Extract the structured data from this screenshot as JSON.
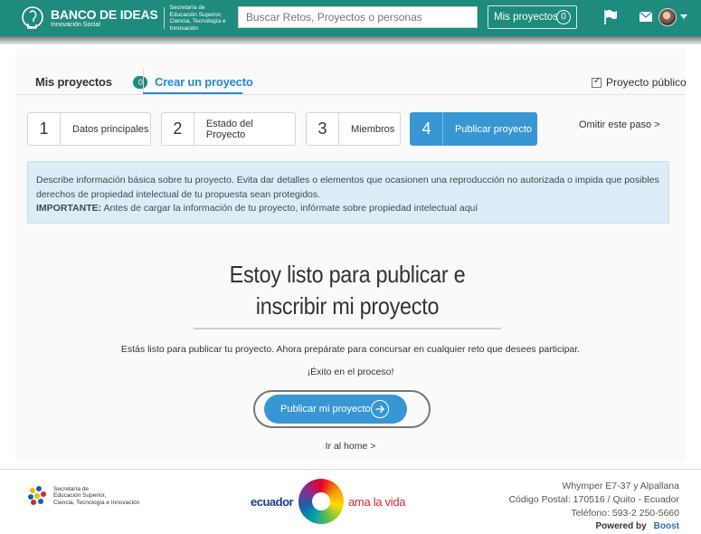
{
  "header": {
    "brand_title": "BANCO DE IDEAS",
    "brand_subtitle": "Innovación Social",
    "org_line1": "Secretaría de",
    "org_line2": "Educación Superior,",
    "org_line3": "Ciencia, Tecnología e Innovación",
    "search_placeholder": "Buscar Retos, Proyectos o personas",
    "my_projects_label": "Mis proyectos",
    "my_projects_count": "0"
  },
  "tabs": {
    "mis_proyectos": "Mis proyectos",
    "mis_proyectos_count": "0",
    "crear_proyecto": "Crear un proyecto",
    "public_label": "Proyecto público"
  },
  "steps": [
    {
      "num": "1",
      "label": "Datos principales"
    },
    {
      "num": "2",
      "label": "Estado del Proyecto"
    },
    {
      "num": "3",
      "label": "Miembros"
    },
    {
      "num": "4",
      "label": "Publicar proyecto"
    }
  ],
  "skip_label": "Omitir este paso >",
  "alert": {
    "line1": "Describe información básica sobre tu proyecto. Evita dar detalles o elementos que ocasionen una reproducción no autorizada o impida que posibles",
    "line2": "derechos de propiedad intelectual de tu propuesta sean protegidos.",
    "important_label": "IMPORTANTE:",
    "important_text": " Antes de cargar la información de tu proyecto, infórmate sobre propiedad intelectual aquí"
  },
  "main": {
    "headline_line1": "Estoy listo para publicar e",
    "headline_line2": "inscribir mi proyecto",
    "ready_text": "Estás listo para publicar tu proyecto. Ahora prepárate para concursar en cualquier reto que desees participar.",
    "success_text": "¡Éxito en el proceso!",
    "publish_label": "Publicar mi proyecto",
    "home_link": "Ir al home >"
  },
  "footer": {
    "org_line1": "Secretaría de",
    "org_line2": "Educación Superior,",
    "org_line3": "Ciencia, Tecnología e Innovación",
    "ecuador_left": "ecuador",
    "ecuador_right": "ama la vida",
    "address_line1": "Whymper E7-37 y Alpallana",
    "address_line2": "Código Postal: 170516 / Quito - Ecuador",
    "address_line3": "Teléfono: 593-2 250-5660",
    "powered_by": "Powered by",
    "powered_brand": "Boost"
  }
}
